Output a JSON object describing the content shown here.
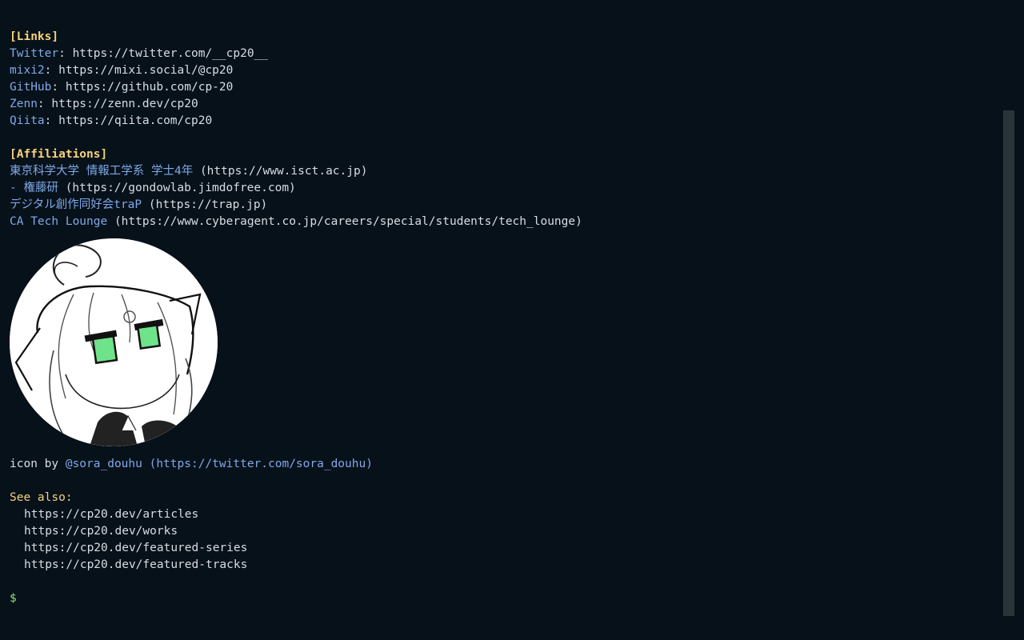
{
  "links": {
    "heading": "[Links]",
    "items": [
      {
        "name": "Twitter",
        "sep": ": ",
        "url": "https://twitter.com/__cp20__"
      },
      {
        "name": "mixi2",
        "sep": ": ",
        "url": "https://mixi.social/@cp20"
      },
      {
        "name": "GitHub",
        "sep": ": ",
        "url": "https://github.com/cp-20"
      },
      {
        "name": "Zenn",
        "sep": ": ",
        "url": "https://zenn.dev/cp20"
      },
      {
        "name": "Qiita",
        "sep": ": ",
        "url": "https://qiita.com/cp20"
      }
    ]
  },
  "affiliations": {
    "heading": "[Affiliations]",
    "items": [
      {
        "name": "東京科学大学 情報工学系 学士4年",
        "url": "(https://www.isct.ac.jp)"
      },
      {
        "name": "- 権藤研",
        "url": "(https://gondowlab.jimdofree.com)"
      },
      {
        "name": "デジタル創作同好会traP",
        "url": "(https://trap.jp)"
      },
      {
        "name": "CA Tech Lounge",
        "url": "(https://www.cyberagent.co.jp/careers/special/students/tech_lounge)"
      }
    ]
  },
  "avatar": {
    "icon": "anime-character-avatar-icon"
  },
  "credit": {
    "prefix": "icon by ",
    "handle": "@sora_douhu (https://twitter.com/sora_douhu)"
  },
  "see_also": {
    "label": "See also:",
    "urls": [
      "https://cp20.dev/articles",
      "https://cp20.dev/works",
      "https://cp20.dev/featured-series",
      "https://cp20.dev/featured-tracks"
    ]
  },
  "prompt": {
    "symbol": "$"
  },
  "colors": {
    "background": "#07111a",
    "text": "#d7dde3",
    "heading": "#f6d27a",
    "link": "#7fa9e8",
    "prompt": "#8ee07a",
    "scrollbar": "#2a3438"
  }
}
